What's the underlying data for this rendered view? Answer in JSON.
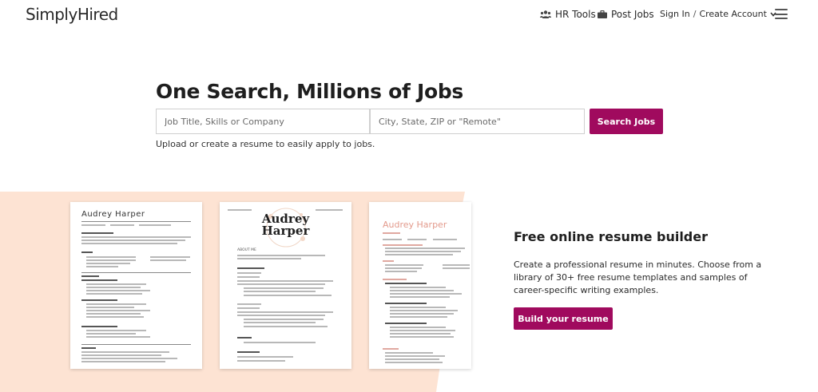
{
  "header": {
    "logo": "SimplyHired",
    "hr_tools": "HR Tools",
    "post_jobs": "Post Jobs",
    "sign_in": "Sign In",
    "separator": "/",
    "create_account": "Create Account"
  },
  "hero": {
    "title": "One Search, Millions of Jobs",
    "what_placeholder": "Job Title, Skills or Company",
    "where_placeholder": "City, State, ZIP or \"Remote\"",
    "search_button": "Search Jobs",
    "upload_link": "Upload",
    "or_text": "or",
    "create_resume_link": "create a resume",
    "upload_suffix": "to easily apply to jobs."
  },
  "resume_builder": {
    "title": "Free online resume builder",
    "description": "Create a professional resume in minutes. Choose from a library of 30+ free resume templates and samples of career-specific writing examples.",
    "button": "Build your resume",
    "template1_name": "Audrey Harper",
    "template2_name_first": "Audrey",
    "template2_name_last": "Harper",
    "template2_section": "ABOUT ME",
    "template3_name": "Audrey Harper"
  },
  "colors": {
    "brand": "#a00a5e",
    "peach": "#fde3d3"
  },
  "icons": {
    "hr_tools": "people-icon",
    "post_jobs": "briefcase-icon",
    "account_chevron": "chevron-down-icon",
    "menu": "hamburger-menu-icon"
  }
}
